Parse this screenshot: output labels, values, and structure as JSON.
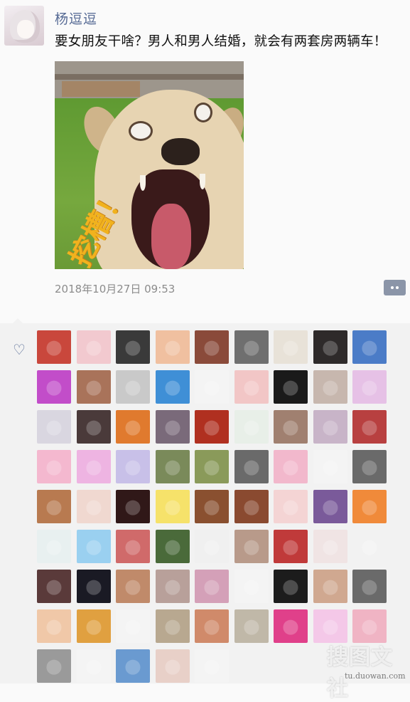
{
  "post": {
    "username": "杨逗逗",
    "text": "要女朋友干啥？男人和男人结婚，就会有两套房两辆车！",
    "image_caption": "挖槽！",
    "timestamp": "2018年10月27日 09:53"
  },
  "icons": {
    "comment_button": "comment-more-icon",
    "like": "heart-outline-icon"
  },
  "likes": {
    "heart_glyph": "♡",
    "avatar_colors": [
      "#c9473c",
      "#f2c9cf",
      "#3a3a3a",
      "#f0c0a0",
      "#8a4a3a",
      "#6f6f6f",
      "#e8e2d8",
      "#2e2a2a",
      "#4b7cc7",
      "#c24dc9",
      "#a9735a",
      "#c9c9c9",
      "#3f8fd6",
      "#f4f4f4",
      "#f2c6c6",
      "#1a1a1a",
      "#c7b7ae",
      "#e6c1e6",
      "#d9d6e0",
      "#4a3a3a",
      "#e07a2e",
      "#7a6a7a",
      "#b03020",
      "#e8efe8",
      "#a08070",
      "#c8b4c8",
      "#b84040",
      "#f4b8cf",
      "#eeb4e2",
      "#c8c0e8",
      "#7a8a5a",
      "#8a9a5a",
      "#6a6a6a",
      "#f2b8cc",
      "#f4f4f4",
      "#6a6a6a",
      "#b87a50",
      "#f0d8d0",
      "#301818",
      "#f6e26a",
      "#8a5030",
      "#8a4a30",
      "#f4d4d4",
      "#7a5a9a",
      "#f08a3a",
      "#e8f0f0",
      "#9ad0f0",
      "#d06a6a",
      "#4a6a3a",
      "#f0f0f0",
      "#b89a8a",
      "#c03a3a",
      "#f0e4e4",
      "#f2f2f2",
      "#5a3a3a",
      "#1a1a24",
      "#c08a6a",
      "#b8a09a",
      "#d4a0b8",
      "#f4f4f4",
      "#1c1c1c",
      "#d0a890",
      "#6a6a6a",
      "#f0c8a8",
      "#e0a040",
      "#f4f4f4",
      "#b8a890",
      "#d08a6a",
      "#c0b8a8",
      "#e0408a",
      "#f4c8e8",
      "#f0b4c4",
      "#9a9a9a",
      "#f4f4f4",
      "#6a9ad0",
      "#e8d0c8",
      "#f4f4f4"
    ]
  }
}
